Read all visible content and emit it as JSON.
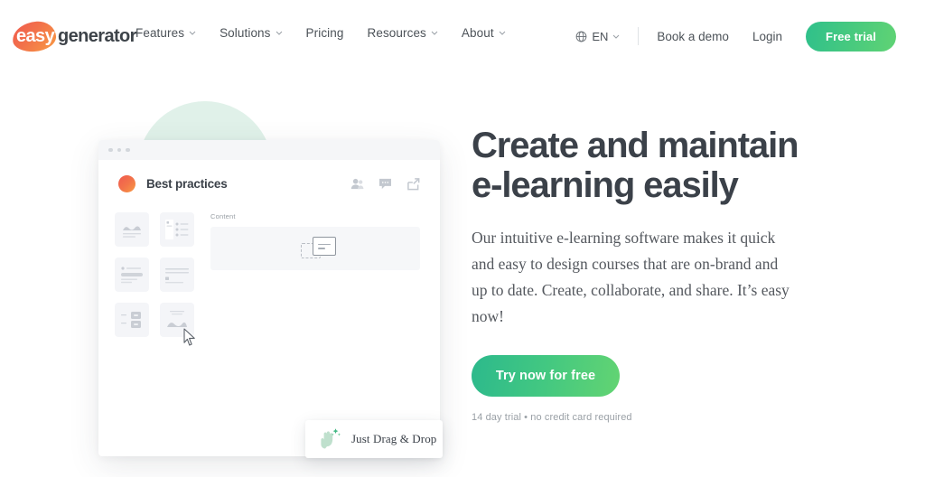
{
  "brand": {
    "logo_easy": "easy",
    "logo_generator": "generator",
    "logo_icon": "easygenerator-blob-logo",
    "accent_orange": "#f2724a",
    "accent_green": "#43c881",
    "headline_color": "#3b4149",
    "mint_blob": "#d6ece1"
  },
  "header": {
    "nav": [
      {
        "label": "Features",
        "has_caret": true
      },
      {
        "label": "Solutions",
        "has_caret": true
      },
      {
        "label": "Pricing",
        "has_caret": false
      },
      {
        "label": "Resources",
        "has_caret": true
      },
      {
        "label": "About",
        "has_caret": true
      }
    ],
    "language": {
      "icon": "globe-icon",
      "label": "EN",
      "has_caret": true
    },
    "book_demo": "Book a demo",
    "login": "Login",
    "free_trial": "Free trial"
  },
  "hero": {
    "headline": "Create and maintain\ne-learning easily",
    "subhead": "Our intuitive e-learning software makes it quick and easy to design courses that are on-brand and up to date. Create, collaborate, and share. It’s easy now!",
    "cta_label": "Try now for free",
    "trial_note": "14 day trial • no credit card required"
  },
  "mockup": {
    "window_dots": 3,
    "course_title": "Best practices",
    "badge_icon": "easygenerator-mark",
    "header_icons": [
      {
        "name": "people-icon"
      },
      {
        "name": "comment-icon"
      },
      {
        "name": "share-icon"
      }
    ],
    "blocks": [
      {
        "name": "image-block"
      },
      {
        "name": "list-block"
      },
      {
        "name": "form-block"
      },
      {
        "name": "text-block"
      },
      {
        "name": "quiz-block"
      },
      {
        "name": "image-text-block"
      }
    ],
    "content_label": "Content",
    "drop_placeholder": "drop-target",
    "cursor": "mouse-pointer"
  },
  "drag_card": {
    "icon": "drag-hand-icon",
    "label": "Just Drag & Drop"
  }
}
